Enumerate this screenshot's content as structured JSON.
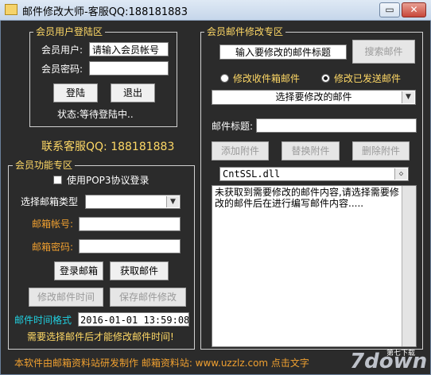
{
  "window": {
    "title": "邮件修改大师-客服QQ:188181883",
    "minimize": "▭",
    "close": "✕"
  },
  "login": {
    "group_title": "会员用户登陆区",
    "user_label": "会员用户:",
    "user_value": "请输入会员帐号",
    "pwd_label": "会员密码:",
    "pwd_value": "",
    "login_btn": "登陆",
    "exit_btn": "退出",
    "status": "状态:等待登陆中.."
  },
  "contact": "联系客服QQ: 188181883",
  "functions": {
    "group_title": "会员功能专区",
    "pop3_label": "使用POP3协议登录",
    "pop3_checked": false,
    "mailbox_type_label": "选择邮箱类型",
    "mailbox_type_value": "",
    "account_label": "邮箱帐号:",
    "account_value": "",
    "password_label": "邮箱密码:",
    "password_value": "",
    "login_mail_btn": "登录邮箱",
    "fetch_mail_btn": "获取邮件",
    "modify_time_btn": "修改邮件时间",
    "save_modify_btn": "保存邮件修改",
    "time_format_label": "邮件时间格式",
    "time_value": "2016-01-01 13:59:08",
    "hint": "需要选择邮件后才能修改邮件时间!"
  },
  "modify": {
    "group_title": "会员邮件修改专区",
    "subject_search_value": "输入要修改的邮件标题",
    "search_btn": "搜索邮件",
    "radio_inbox": "修改收件箱邮件",
    "radio_sent": "修改已发送邮件",
    "select_mail": "选择要修改的邮件",
    "subject_label": "邮件标题:",
    "subject_value": "",
    "add_attach_btn": "添加附件",
    "replace_attach_btn": "替换附件",
    "delete_attach_btn": "删除附件",
    "attachment": "CntSSL.dll",
    "content": "未获取到需要修改的邮件内容,请选择需要修改的邮件后在进行编写邮件内容....."
  },
  "footer": "本软件由邮箱资料站研发制作  邮箱资料站: www.uzzlz.com  点击文字",
  "watermark": "7down",
  "watermark_sub": "第七下载"
}
